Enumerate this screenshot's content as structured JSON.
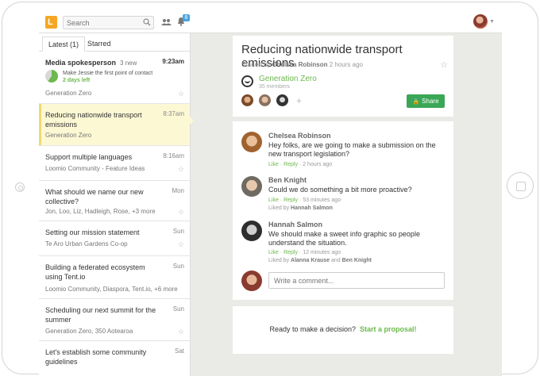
{
  "topbar": {
    "search_placeholder": "Search",
    "notification_count": "8"
  },
  "tabs": [
    {
      "label": "Latest (1)"
    },
    {
      "label": "Starred"
    }
  ],
  "threads": [
    {
      "title": "Media spokesperson",
      "new": "3 new",
      "time": "9:23am",
      "progress_text_line1": "Make Jessie the first point of contact",
      "progress_text_line2": "2 days left",
      "progress_percent": 60,
      "group": "Generation Zero"
    },
    {
      "title": "Reducing nationwide transport emissions",
      "time": "8:37am",
      "group": "Generation Zero"
    },
    {
      "title": "Support multiple languages",
      "time": "8:16am",
      "group": "Loomio Community - Feature Ideas"
    },
    {
      "title": "What should we name our new collective?",
      "time": "Mon",
      "group": "Jon, Loo, Liz, Hadleigh, Rose, +3 more"
    },
    {
      "title": "Setting our mission statement",
      "time": "Sun",
      "group": "Te Aro Urban Gardens Co-op"
    },
    {
      "title": "Building a federated ecosystem using Tent.io",
      "time": "Sun",
      "group": "Loomio Community, Diaspora, Tent.io, +6 more"
    },
    {
      "title": "Scheduling our next summit for the summer",
      "time": "Sun",
      "group": "Generation Zero, 350 Aotearoa"
    },
    {
      "title": "Let's establish some community guidelines",
      "time": "Sat"
    }
  ],
  "discussion": {
    "title": "Reducing nationwide transport emissions",
    "started_prefix": "Started by",
    "author": "Chelsea Robinson",
    "started_ago": "2 hours ago",
    "group_name": "Generation Zero",
    "members": "35 members",
    "share_label": "Share"
  },
  "comments": [
    {
      "name": "Chelsea Robinson",
      "body": "Hey folks, are we going to make a submission on the new transport legislation?",
      "like": "Like",
      "reply": "Reply",
      "ago": "2 hours ago"
    },
    {
      "name": "Ben Knight",
      "body": "Could we do something a bit more proactive?",
      "like": "Like",
      "reply": "Reply",
      "ago": "53 minutes ago",
      "liked_prefix": "Liked by",
      "liked_by": "Hannah Salmon"
    },
    {
      "name": "Hannah Salmon",
      "body": "We should make a sweet info graphic so people understand the situation.",
      "like": "Like",
      "reply": "Reply",
      "ago": "12 minutes ago",
      "liked_prefix": "Liked by",
      "liked_by": "Alanna Krause",
      "liked_and": "and",
      "liked_by2": "Ben Knight"
    }
  ],
  "comment_input_placeholder": "Write a comment...",
  "proposal": {
    "prompt": "Ready to make a decision?",
    "action": "Start a proposal!"
  },
  "colors": {
    "accent_green": "#6cb84c",
    "share_green": "#3aa757",
    "logo_orange": "#f5a623",
    "badge_blue": "#4aa3df",
    "selected_bg": "#fdf8d4"
  }
}
